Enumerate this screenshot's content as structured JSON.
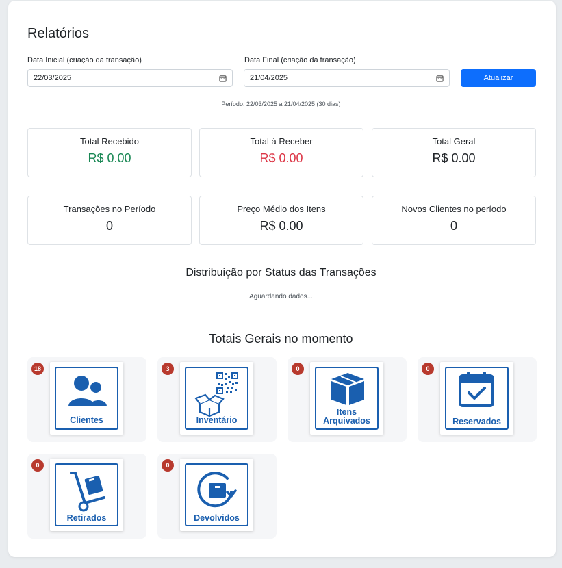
{
  "page": {
    "title": "Relatórios"
  },
  "filters": {
    "start_label": "Data Inicial (criação da transação)",
    "start_value": "22/03/2025",
    "end_label": "Data Final (criação da transação)",
    "end_value": "21/04/2025",
    "update_button": "Atualizar",
    "period_text": "Período: 22/03/2025 a 21/04/2025 (30 dias)"
  },
  "stats": [
    {
      "label": "Total Recebido",
      "value": "R$ 0.00",
      "color": "#198754"
    },
    {
      "label": "Total à Receber",
      "value": "R$ 0.00",
      "color": "#dc3545"
    },
    {
      "label": "Total Geral",
      "value": "R$ 0.00"
    },
    {
      "label": "Transações no Período",
      "value": "0"
    },
    {
      "label": "Preço Médio dos Itens",
      "value": "R$ 0.00"
    },
    {
      "label": "Novos Clientes no período",
      "value": "0"
    }
  ],
  "status_section": {
    "title": "Distribuição por Status das Transações",
    "waiting": "Aguardando dados..."
  },
  "totals_section": {
    "title": "Totais Gerais no momento",
    "tiles": [
      {
        "label": "Clientes",
        "count": "18",
        "icon": "users-icon"
      },
      {
        "label": "Inventário",
        "count": "3",
        "icon": "qr-box-icon"
      },
      {
        "label_line1": "Itens",
        "label_line2": "Arquivados",
        "count": "0",
        "icon": "archive-box-icon"
      },
      {
        "label": "Reservados",
        "count": "0",
        "icon": "calendar-check-icon"
      },
      {
        "label": "Retirados",
        "count": "0",
        "icon": "hand-truck-icon"
      },
      {
        "label": "Devolvidos",
        "count": "0",
        "icon": "return-box-icon"
      }
    ]
  },
  "colors": {
    "accent": "#0d6efd",
    "icon_blue": "#1a5faf",
    "badge": "#b83a2e"
  }
}
